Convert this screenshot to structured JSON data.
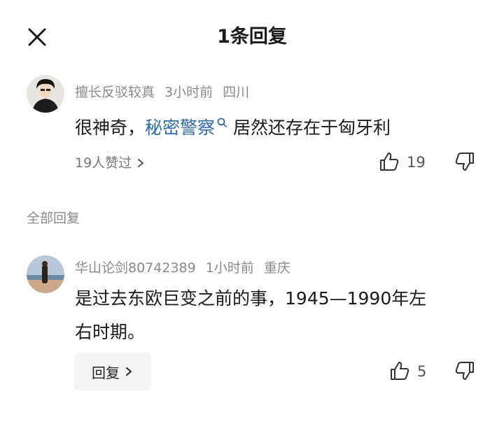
{
  "header": {
    "title": "1条回复",
    "close_icon": "close-icon"
  },
  "main_comment": {
    "username": "擅长反驳较真",
    "time": "3小时前",
    "location": "四川",
    "text_before": "很神奇，",
    "link_text": "秘密警察",
    "text_after": " 居然还存在于匈牙利",
    "likes_summary": "19人赞过",
    "like_count": "19",
    "icons": [
      "thumbs-up-icon",
      "thumbs-down-icon",
      "search-icon",
      "chevron-right-icon"
    ]
  },
  "section": {
    "label": "全部回复"
  },
  "replies": [
    {
      "username": "华山论剑80742389",
      "time": "1小时前",
      "location": "重庆",
      "line1": "是过去东欧巨变之前的事，1945—1990年左",
      "line2": "右时期。",
      "reply_label": "回复",
      "like_count": "5"
    }
  ],
  "colors": {
    "link": "#2e6aa8",
    "meta": "#8a8a8a",
    "background": "#ffffff"
  }
}
